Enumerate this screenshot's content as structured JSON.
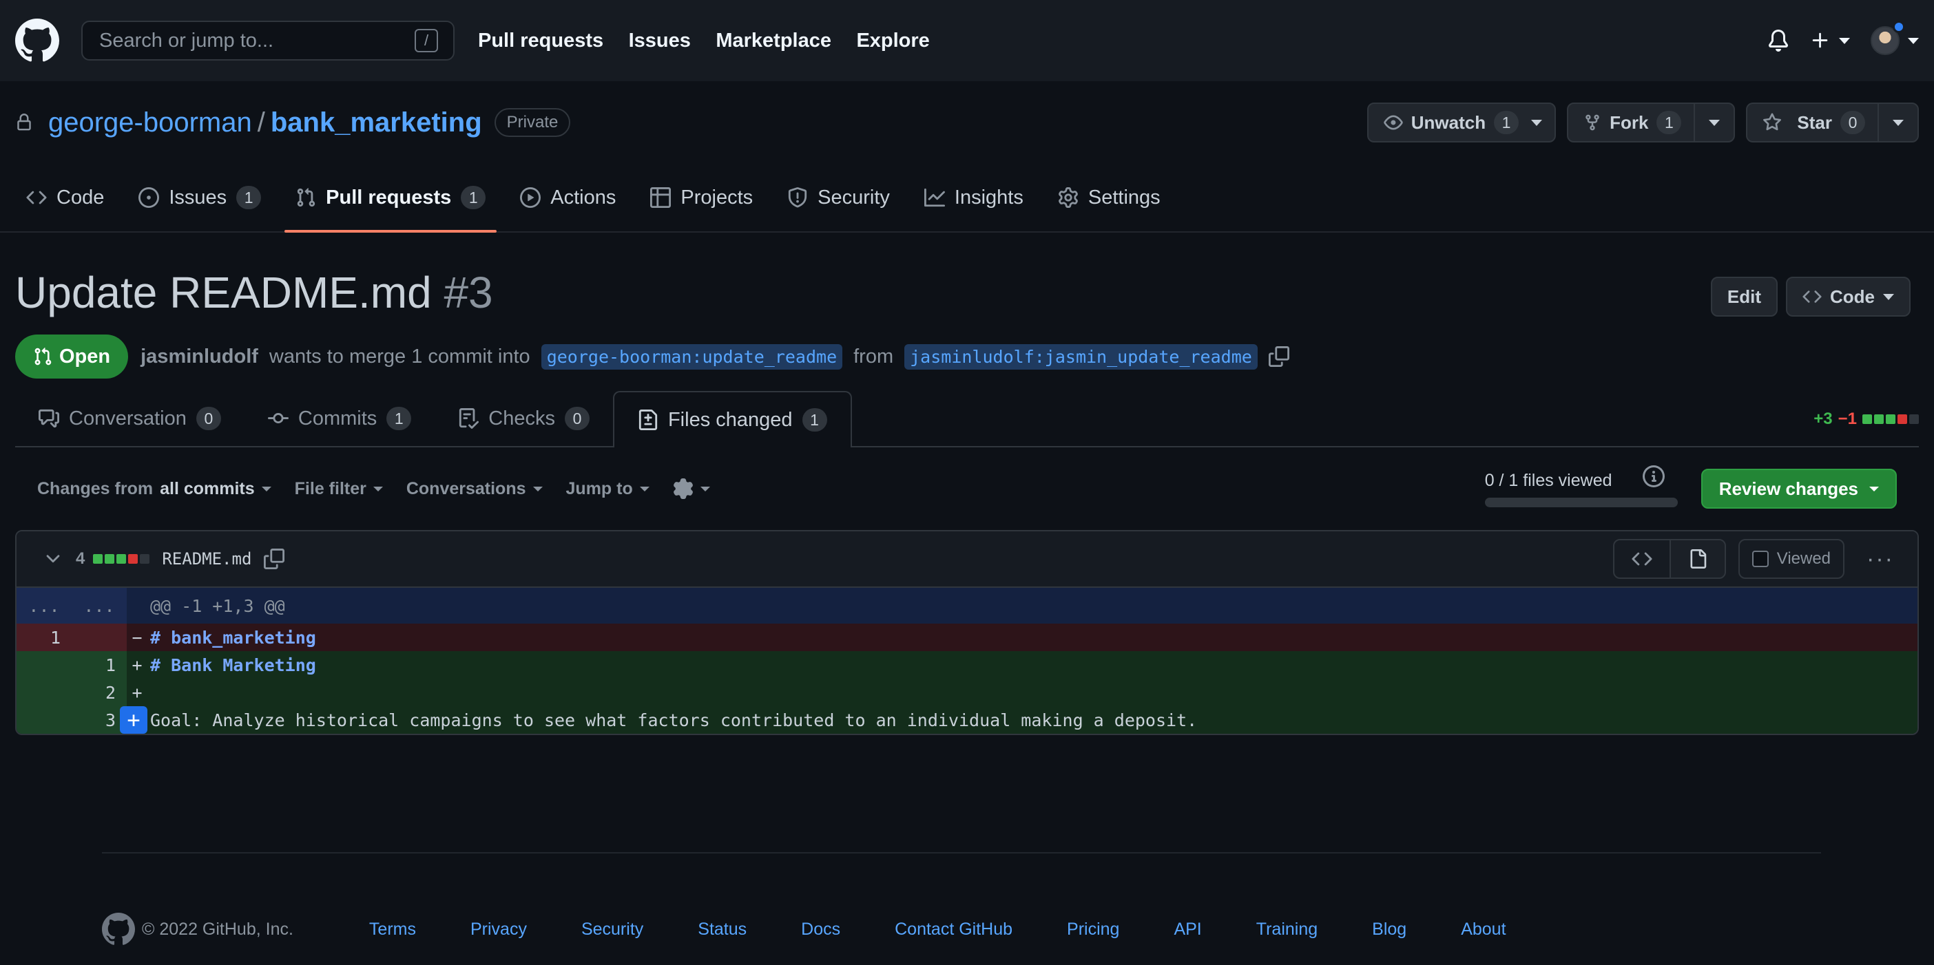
{
  "header": {
    "search_placeholder": "Search or jump to...",
    "search_shortcut": "/",
    "nav": [
      "Pull requests",
      "Issues",
      "Marketplace",
      "Explore"
    ]
  },
  "repo": {
    "owner": "george-boorman",
    "separator": "/",
    "name": "bank_marketing",
    "visibility": "Private",
    "unwatch_label": "Unwatch",
    "unwatch_count": "1",
    "fork_label": "Fork",
    "fork_count": "1",
    "star_label": "Star",
    "star_count": "0"
  },
  "repo_tabs": [
    {
      "label": "Code",
      "icon": "code-icon"
    },
    {
      "label": "Issues",
      "count": "1",
      "icon": "issue-opened-icon"
    },
    {
      "label": "Pull requests",
      "count": "1",
      "icon": "git-pull-request-icon",
      "active": true
    },
    {
      "label": "Actions",
      "icon": "play-icon"
    },
    {
      "label": "Projects",
      "icon": "table-icon"
    },
    {
      "label": "Security",
      "icon": "shield-icon"
    },
    {
      "label": "Insights",
      "icon": "graph-icon"
    },
    {
      "label": "Settings",
      "icon": "gear-icon"
    }
  ],
  "pr": {
    "title": "Update README.md",
    "number": "#3",
    "edit_label": "Edit",
    "code_label": "Code",
    "state": "Open",
    "author": "jasminludolf",
    "merge_text": "wants to merge 1 commit into",
    "base_branch": "george-boorman:update_readme",
    "from_text": "from",
    "head_branch": "jasminludolf:jasmin_update_readme"
  },
  "pr_tabs": [
    {
      "label": "Conversation",
      "count": "0",
      "icon": "comment-discussion-icon"
    },
    {
      "label": "Commits",
      "count": "1",
      "icon": "git-commit-icon"
    },
    {
      "label": "Checks",
      "count": "0",
      "icon": "checklist-icon"
    },
    {
      "label": "Files changed",
      "count": "1",
      "icon": "file-diff-icon",
      "active": true
    }
  ],
  "diffstat": {
    "additions": "+3",
    "deletions": "−1"
  },
  "toolbar": {
    "changes_prefix": "Changes from",
    "changes_value": "all commits",
    "file_filter": "File filter",
    "conversations": "Conversations",
    "jump_to": "Jump to",
    "files_viewed": "0 / 1 files viewed",
    "files_viewed_fraction": 0,
    "review_label": "Review changes"
  },
  "file": {
    "changes_count": "4",
    "name": "README.md",
    "viewed_label": "Viewed",
    "hunk_left": "...",
    "hunk_right": "...",
    "hunk_header": "@@ -1 +1,3 @@",
    "lines": [
      {
        "type": "del",
        "old": "1",
        "new": "",
        "sign": "−",
        "text": "# bank_marketing"
      },
      {
        "type": "add",
        "old": "",
        "new": "1",
        "sign": "+",
        "text": "# Bank Marketing"
      },
      {
        "type": "add",
        "old": "",
        "new": "2",
        "sign": "+",
        "text": ""
      },
      {
        "type": "add",
        "old": "",
        "new": "3",
        "sign": "+",
        "text": "Goal: Analyze historical campaigns to see what factors contributed to an individual making a deposit."
      }
    ]
  },
  "footer": {
    "copyright": "© 2022 GitHub, Inc.",
    "links": [
      "Terms",
      "Privacy",
      "Security",
      "Status",
      "Docs",
      "Contact GitHub",
      "Pricing",
      "API",
      "Training",
      "Blog",
      "About"
    ]
  },
  "colors": {
    "accent": "#58a6ff",
    "success": "#238636",
    "danger": "#f85149",
    "tab_underline": "#f78166"
  }
}
